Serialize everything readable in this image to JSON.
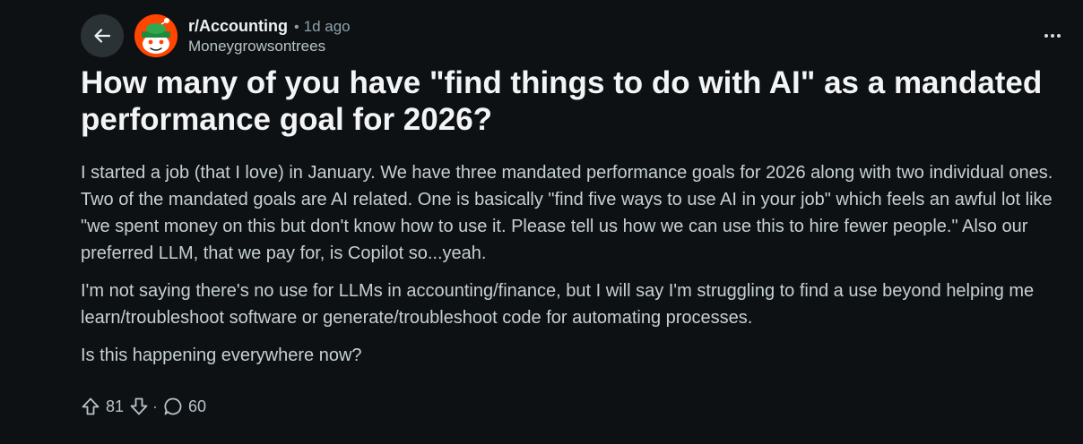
{
  "post": {
    "subreddit": "r/Accounting",
    "separator": "•",
    "time_ago": "1d ago",
    "author": "Moneygrowsontrees",
    "title": "How many of you have \"find things to do with AI\" as a mandated performance goal for 2026?",
    "paragraphs": [
      "I started a job (that I love) in January. We have three mandated performance goals for 2026 along with two individual ones. Two of the mandated goals are AI related. One is basically \"find five ways to use AI in your job\" which feels an awful lot like \"we spent money on this but don't know how to use it. Please tell us how we can use this to hire fewer people.\" Also our preferred LLM, that we pay for, is Copilot so...yeah.",
      "I'm not saying there's no use for LLMs in accounting/finance, but I will say I'm struggling to find a use beyond helping me learn/troubleshoot software or generate/troubleshoot code for automating processes.",
      "Is this happening everywhere now?"
    ],
    "upvotes": "81",
    "actions_separator": "·",
    "comments": "60"
  },
  "icons": {
    "back": "arrow-left-icon",
    "more": "more-horizontal-icon",
    "upvote": "upvote-arrow-icon",
    "downvote": "downvote-arrow-icon",
    "comment": "comment-bubble-icon"
  },
  "colors": {
    "background": "#0e1113",
    "avatar": "#ff4500",
    "title": "#f2f4f5",
    "body": "#c6d0d4",
    "muted": "#8ba2ad"
  }
}
